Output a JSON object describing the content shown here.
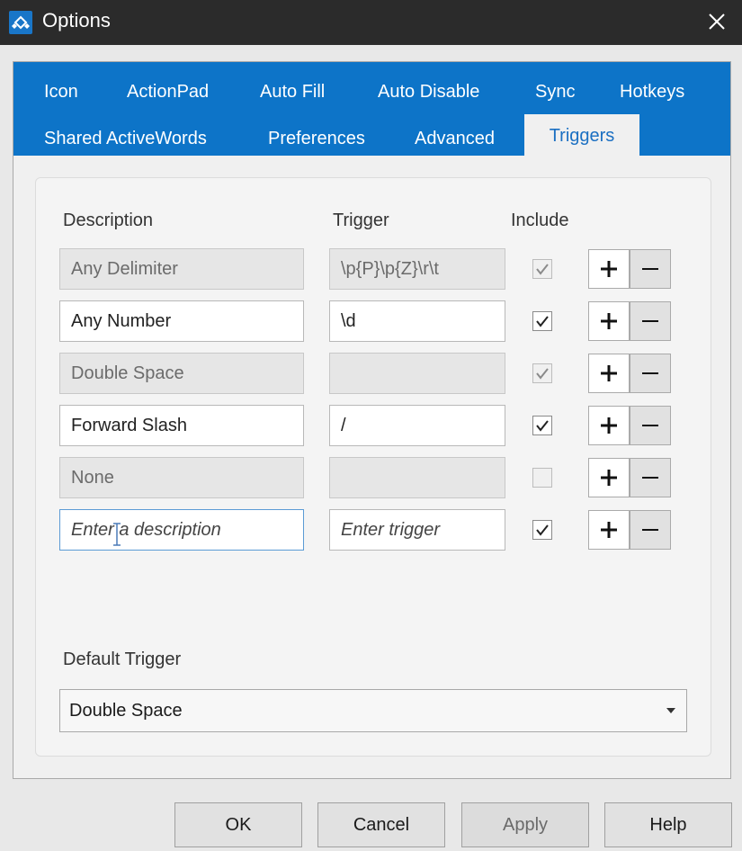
{
  "window": {
    "title": "Options",
    "accent": "#0d74c8"
  },
  "tabs": {
    "row1": [
      "Icon",
      "ActionPad",
      "Auto Fill",
      "Auto Disable",
      "Sync",
      "Hotkeys"
    ],
    "row2": [
      "Shared ActiveWords",
      "Preferences",
      "Advanced",
      "Triggers"
    ],
    "active": "Triggers"
  },
  "columns": {
    "description": "Description",
    "trigger": "Trigger",
    "include": "Include"
  },
  "rows": [
    {
      "description": "Any Delimiter",
      "trigger": "\\p{P}\\p{Z}\\r\\t",
      "include": true,
      "editable": false
    },
    {
      "description": "Any Number",
      "trigger": "\\d",
      "include": true,
      "editable": true
    },
    {
      "description": "Double Space",
      "trigger": "",
      "include": true,
      "editable": false
    },
    {
      "description": "Forward Slash",
      "trigger": "/",
      "include": true,
      "editable": true
    },
    {
      "description": "None",
      "trigger": "",
      "include": false,
      "editable": false
    }
  ],
  "new_row": {
    "description_placeholder": "Enter a description",
    "trigger_placeholder": "Enter trigger",
    "include": true
  },
  "default_trigger": {
    "label": "Default Trigger",
    "value": "Double Space"
  },
  "buttons": {
    "ok": "OK",
    "cancel": "Cancel",
    "apply": "Apply",
    "help": "Help"
  }
}
